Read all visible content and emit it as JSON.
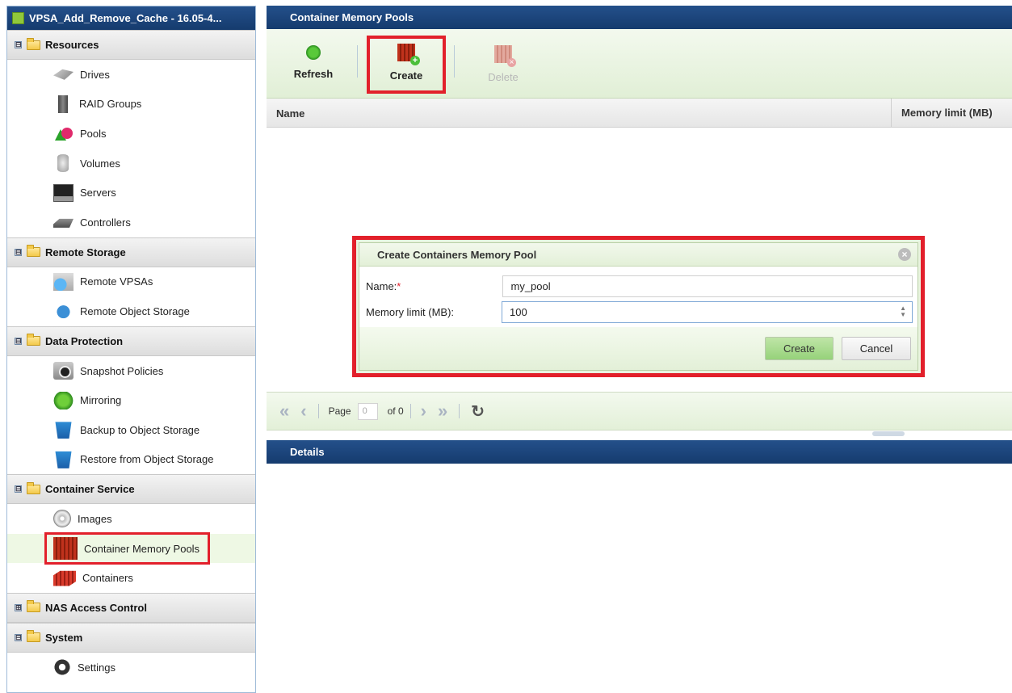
{
  "sidebar": {
    "title": "VPSA_Add_Remove_Cache - 16.05-4...",
    "groups": [
      {
        "label": "Resources",
        "toggle": "⊟",
        "items": [
          {
            "label": "Drives",
            "icon": "drives-icon"
          },
          {
            "label": "RAID Groups",
            "icon": "raid-groups-icon"
          },
          {
            "label": "Pools",
            "icon": "pools-icon"
          },
          {
            "label": "Volumes",
            "icon": "volumes-icon"
          },
          {
            "label": "Servers",
            "icon": "servers-icon"
          },
          {
            "label": "Controllers",
            "icon": "controllers-icon"
          }
        ]
      },
      {
        "label": "Remote Storage",
        "toggle": "⊟",
        "items": [
          {
            "label": "Remote VPSAs",
            "icon": "remote-vpsa-icon"
          },
          {
            "label": "Remote Object Storage",
            "icon": "remote-object-storage-icon"
          }
        ]
      },
      {
        "label": "Data Protection",
        "toggle": "⊟",
        "items": [
          {
            "label": "Snapshot Policies",
            "icon": "snapshot-icon"
          },
          {
            "label": "Mirroring",
            "icon": "mirroring-icon"
          },
          {
            "label": "Backup to Object Storage",
            "icon": "backup-icon"
          },
          {
            "label": "Restore from Object Storage",
            "icon": "restore-icon"
          }
        ]
      },
      {
        "label": "Container Service",
        "toggle": "⊟",
        "items": [
          {
            "label": "Images",
            "icon": "images-icon"
          },
          {
            "label": "Container Memory Pools",
            "icon": "memory-pools-icon",
            "selected": true
          },
          {
            "label": "Containers",
            "icon": "containers-icon"
          }
        ]
      },
      {
        "label": "NAS Access Control",
        "toggle": "⊞",
        "items": []
      },
      {
        "label": "System",
        "toggle": "⊟",
        "items": [
          {
            "label": "Settings",
            "icon": "settings-icon"
          }
        ]
      }
    ]
  },
  "main": {
    "title": "Container Memory Pools",
    "toolbar": {
      "refresh_label": "Refresh",
      "create_label": "Create",
      "delete_label": "Delete"
    },
    "grid": {
      "columns": [
        "Name",
        "Memory limit (MB)"
      ],
      "rows": []
    },
    "pager": {
      "page_label": "Page",
      "page_value": "0",
      "of_label": "of 0"
    },
    "details_title": "Details"
  },
  "dialog": {
    "title": "Create Containers Memory Pool",
    "name_label": "Name:",
    "required_mark": "*",
    "name_value": "my_pool",
    "memory_label": "Memory limit (MB):",
    "memory_value": "100",
    "create_label": "Create",
    "cancel_label": "Cancel"
  },
  "colors": {
    "header_blue": "#1a437a",
    "highlight_red": "#e2202b",
    "toolbar_green": "#e1efd6",
    "create_button_green": "#96d27a"
  }
}
